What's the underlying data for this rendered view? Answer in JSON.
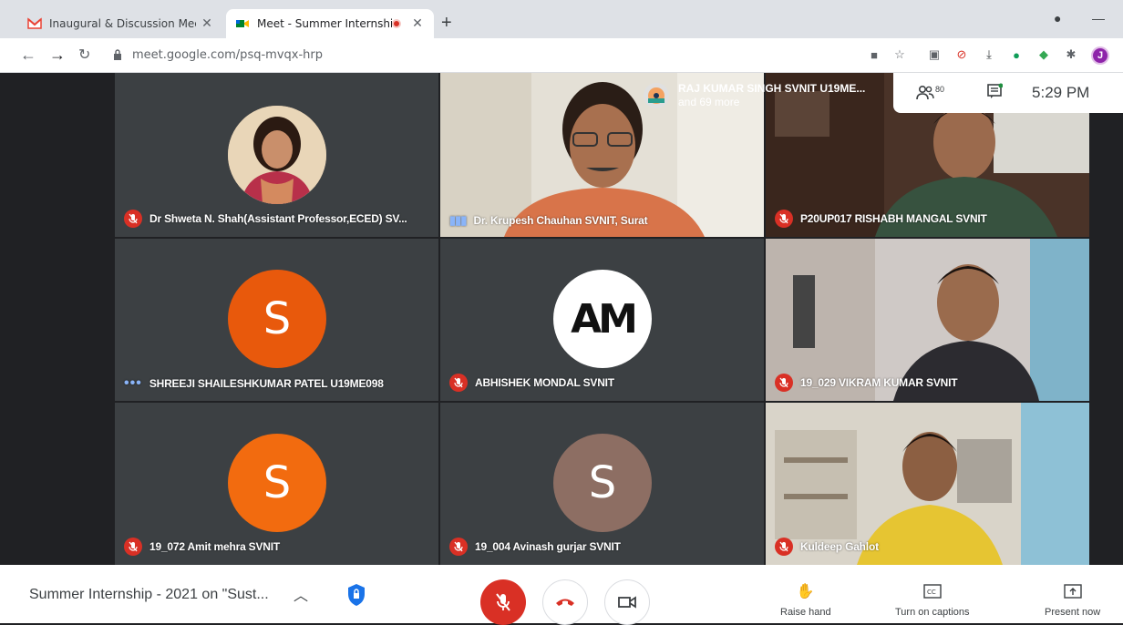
{
  "browser": {
    "tabs": [
      {
        "title": "Inaugural & Discussion Meeting",
        "icon": "gmail-icon"
      },
      {
        "title": "Meet - Summer Internship -",
        "icon": "meet-icon",
        "recording": true
      }
    ],
    "url": "meet.google.com/psq-mvqx-hrp"
  },
  "meet": {
    "others_line1": "RAJ KUMAR SINGH SVNIT U19ME...",
    "others_line2": "and 69 more",
    "participant_count": "80",
    "time": "5:29 PM",
    "meeting_title": "Summer Internship - 2021 on \"Sust...",
    "controls": {
      "raise_hand": "Raise hand",
      "captions": "Turn on captions",
      "present": "Present now"
    }
  },
  "tiles": [
    {
      "name": "Dr Shweta N. Shah(Assistant Professor,ECED) SV...",
      "type": "photo",
      "muted": true
    },
    {
      "name": "Dr. Krupesh Chauhan SVNIT, Surat",
      "type": "video",
      "muted": false
    },
    {
      "name": "P20UP017 RISHABH MANGAL SVNIT",
      "type": "video",
      "muted": true
    },
    {
      "name": "SHREEJI SHAILESHKUMAR PATEL U19ME098",
      "type": "initial",
      "initial": "S",
      "color": "#e8590c",
      "muted": false
    },
    {
      "name": "ABHISHEK MONDAL SVNIT",
      "type": "logo",
      "initial": "AM",
      "muted": true
    },
    {
      "name": "19_029 VIKRAM KUMAR SVNIT",
      "type": "video",
      "muted": true
    },
    {
      "name": "19_072 Amit mehra SVNIT",
      "type": "initial",
      "initial": "S",
      "color": "#f26b0f",
      "muted": true
    },
    {
      "name": "19_004 Avinash gurjar SVNIT",
      "type": "initial",
      "initial": "S",
      "color": "#8d6e63",
      "muted": true
    },
    {
      "name": "Kuldeep Gahlot",
      "type": "video",
      "muted": true
    }
  ],
  "colors": {
    "mic_off": "#d93025",
    "stage": "#202124",
    "tile": "#3c4043",
    "active_blue": "#1a73e8"
  }
}
